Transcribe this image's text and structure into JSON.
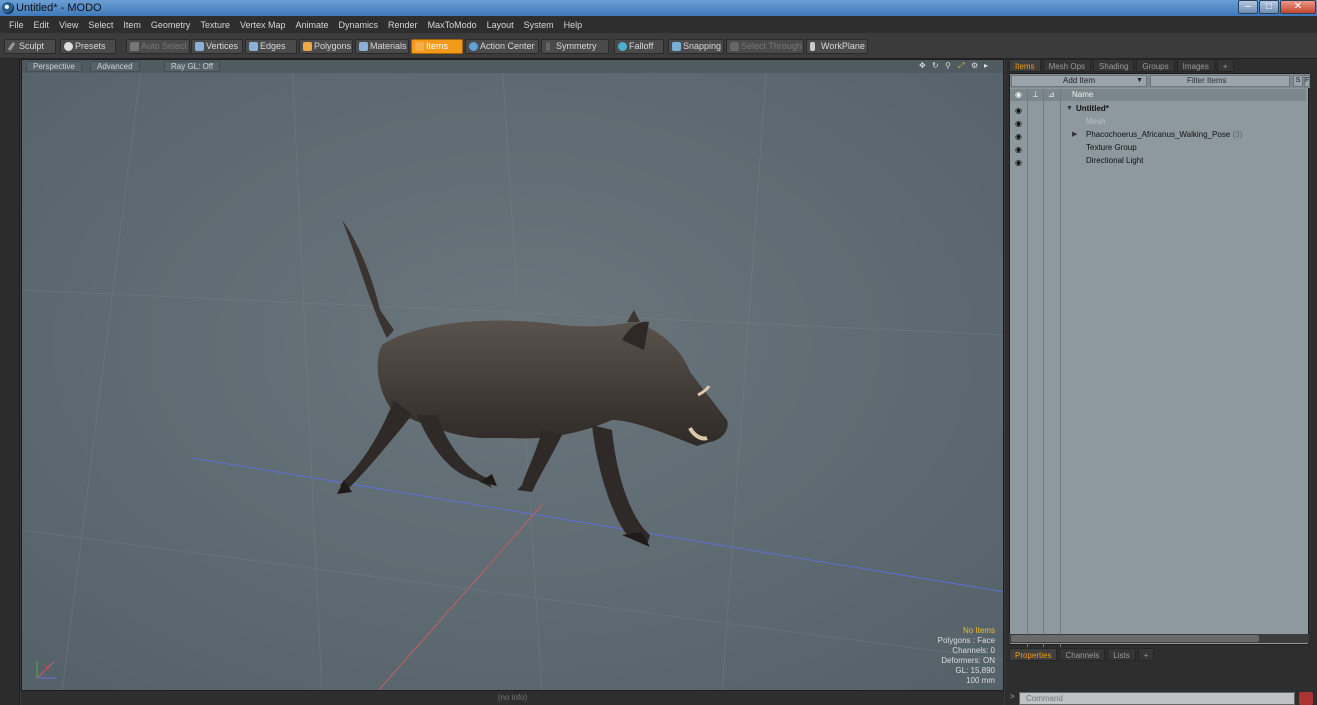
{
  "window": {
    "title": "Untitled* - MODO"
  },
  "menu": [
    "File",
    "Edit",
    "View",
    "Select",
    "Item",
    "Geometry",
    "Texture",
    "Vertex Map",
    "Animate",
    "Dynamics",
    "Render",
    "MaxToModo",
    "Layout",
    "System",
    "Help"
  ],
  "toolbar": {
    "sculpt": "Sculpt",
    "presets": "Presets",
    "auto_select": "Auto Select",
    "vertices": "Vertices",
    "edges": "Edges",
    "polygons": "Polygons",
    "materials": "Materials",
    "items": "Items",
    "action_center": "Action Center",
    "symmetry": "Symmetry",
    "falloff": "Falloff",
    "snapping": "Snapping",
    "select_through": "Select Through",
    "workplane": "WorkPlane",
    "accent_color": "#f29a1a"
  },
  "viewport": {
    "view": "Perspective",
    "shading": "Advanced",
    "raygl": "Ray GL: Off",
    "hud": {
      "items": "No Items",
      "polygons": "Polygons : Face",
      "channels": "Channels: 0",
      "deformers": "Deformers: ON",
      "gl": "GL: 15,890",
      "scale": "100 mm"
    },
    "axis_label": "X"
  },
  "statusbar": {
    "info": "(no info)"
  },
  "right_panel": {
    "tabs": [
      "Items",
      "Mesh Ops",
      "Shading",
      "Groups",
      "Images",
      "+"
    ],
    "add_item": "Add Item",
    "filter_items": "Filter Items",
    "filter_buttons": [
      "S",
      "F"
    ],
    "column_name": "Name",
    "tree": [
      {
        "label": "Untitled*",
        "count": ""
      },
      {
        "label": "Mesh",
        "count": ""
      },
      {
        "label": "Phacochoerus_Africanus_Walking_Pose",
        "count": "(3)"
      },
      {
        "label": "Texture Group",
        "count": ""
      },
      {
        "label": "Directional Light",
        "count": ""
      }
    ],
    "bottom_tabs": [
      "Properties",
      "Channels",
      "Lists",
      "+"
    ],
    "command_placeholder": "Command"
  }
}
